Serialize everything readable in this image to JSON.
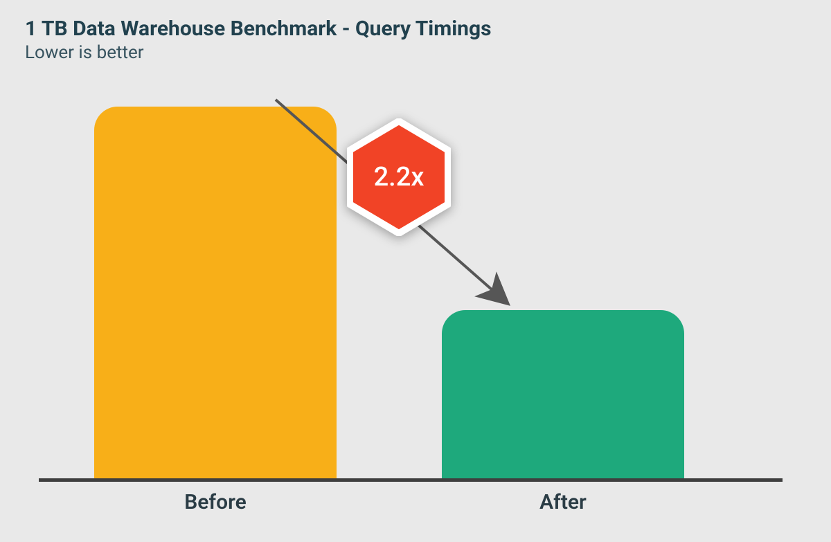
{
  "title": "1 TB Data Warehouse Benchmark -  Query Timings",
  "subtitle": "Lower is better",
  "bars": {
    "before_label": "Before",
    "after_label": "After"
  },
  "callout": {
    "value": "2.2x"
  },
  "colors": {
    "before_bar": "#f8af18",
    "after_bar": "#1ea97c",
    "baseline": "#3e3e3e",
    "badge_fill": "#f14326",
    "badge_border": "#ffffff",
    "text_dark": "#21414e"
  },
  "chart_data": {
    "type": "bar",
    "categories": [
      "Before",
      "After"
    ],
    "values": [
      100,
      45.5
    ],
    "title": "1 TB Data Warehouse Benchmark -  Query Timings",
    "subtitle": "Lower is better",
    "xlabel": "",
    "ylabel": "",
    "ylim": [
      0,
      100
    ],
    "annotations": [
      {
        "text": "2.2x",
        "type": "ratio-callout",
        "from": "Before",
        "to": "After"
      }
    ],
    "grid": false,
    "legend": false
  }
}
